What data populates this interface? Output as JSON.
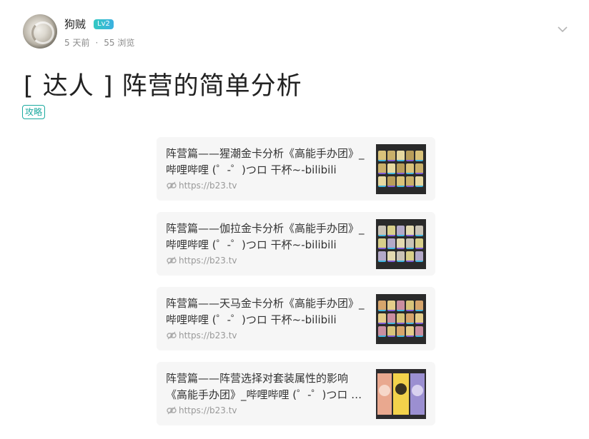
{
  "author": {
    "name": "狗贼",
    "level": "Lv2",
    "time": "5 天前",
    "separator": "·",
    "views": "55 浏览"
  },
  "post": {
    "title": "[ 达人 ] 阵营的简单分析",
    "tag": "攻略"
  },
  "links": [
    {
      "title": "阵营篇——猩潮金卡分析《高能手办团》_哔哩哔哩 (゜-゜)つロ 干杯~-bilibili",
      "url": "https://b23.tv"
    },
    {
      "title": "阵营篇——伽拉金卡分析《高能手办团》_哔哩哔哩 (゜-゜)つロ 干杯~-bilibili",
      "url": "https://b23.tv"
    },
    {
      "title": "阵营篇——天马金卡分析《高能手办团》_哔哩哔哩 (゜-゜)つロ 干杯~-bilibili",
      "url": "https://b23.tv"
    },
    {
      "title": "阵营篇——阵营选择对套装属性的影响《高能手办团》_哔哩哔哩 (゜-゜)つロ 干杯~-bilibili",
      "url": "https://b23.tv"
    }
  ],
  "icons": {
    "expand": "chevron-down-icon",
    "link": "link-icon"
  },
  "colors": {
    "accent": "#1ba99f",
    "level_badge": "#33c8c2",
    "card_bg": "#f6f6f6"
  }
}
